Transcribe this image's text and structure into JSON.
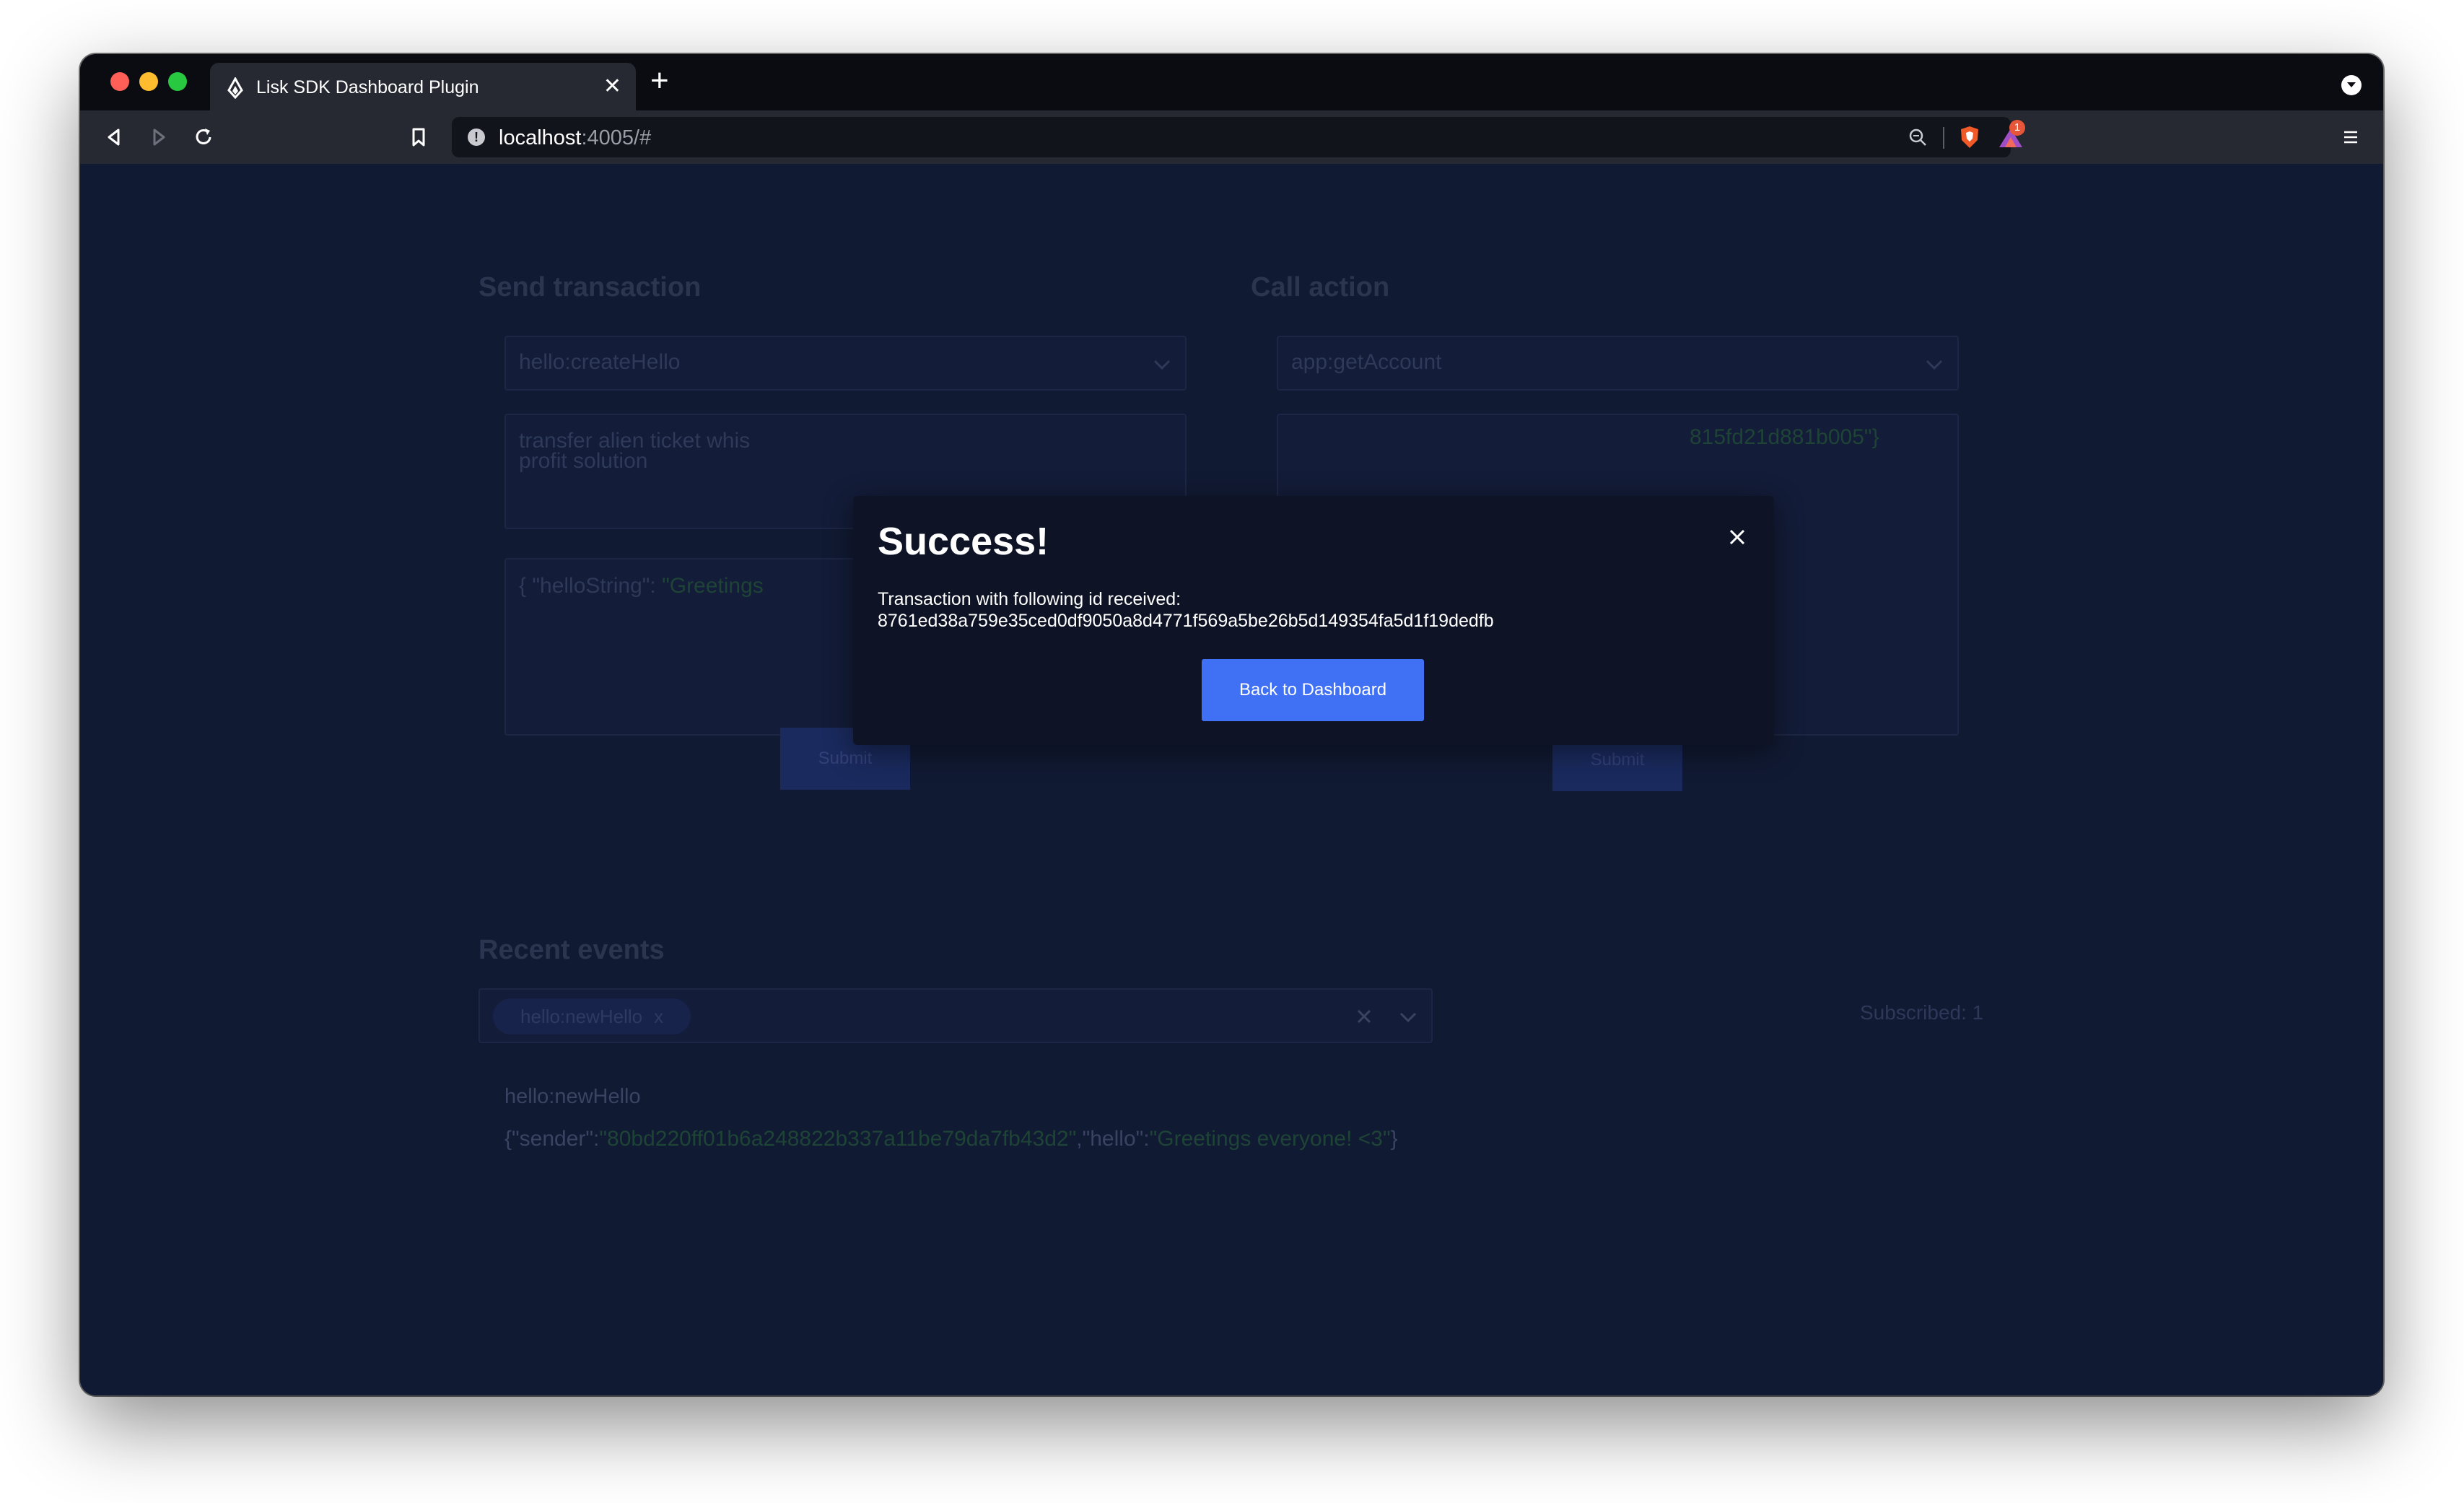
{
  "browser": {
    "tab_title": "Lisk SDK Dashboard Plugin",
    "url_host": "localhost",
    "url_rest": ":4005/#",
    "notification_count": "1"
  },
  "send_transaction": {
    "title": "Send transaction",
    "selected_asset": "hello:createHello",
    "passphrase": "transfer alien ticket whis profit solution",
    "asset_json_key": "{ \"helloString\": ",
    "asset_json_value": "\"Greetings",
    "submit_label": "Submit"
  },
  "call_action": {
    "title": "Call action",
    "selected_action": "app:getAccount",
    "params_visible": "815fd21d881b005\"}",
    "submit_label": "Submit"
  },
  "recent_events": {
    "title": "Recent events",
    "chip_label": "hello:newHello",
    "subscribed_label": "Subscribed: 1",
    "event_name": "hello:newHello",
    "event_data_p1": "{\"sender\":",
    "event_data_v1": "\"80bd220ff01b6a248822b337a11be79da7fb43d2\"",
    "event_data_p2": ",\"hello\":",
    "event_data_v2": "\"Greetings everyone! <3\"",
    "event_data_p3": "}"
  },
  "modal": {
    "title": "Success!",
    "message_line1": "Transaction with following id received:",
    "message_line2": "8761ed38a759e35ced0df9050a8d4771f569a5be26b5d149354fa5d1f19dedfb",
    "button_label": "Back to Dashboard"
  },
  "colors": {
    "page_bg": "#111a33",
    "accent": "#4070f4",
    "modal_bg": "#0e1426"
  }
}
